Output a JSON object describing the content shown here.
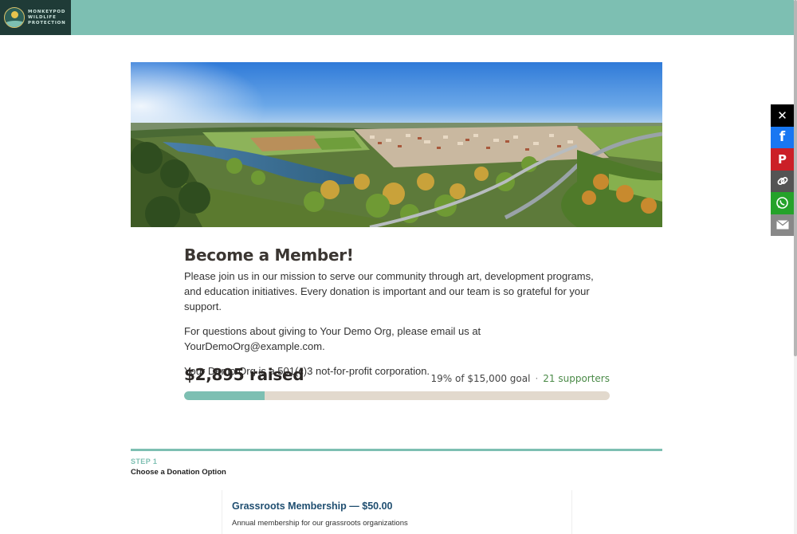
{
  "header": {
    "logo_lines": [
      "MONKEYPOD",
      "WILDLIFE",
      "PROTECTION"
    ],
    "brand_color": "#7dbfb2"
  },
  "share": [
    {
      "name": "x-icon",
      "glyph": "✕",
      "color": "#000000"
    },
    {
      "name": "facebook-icon",
      "glyph": "f",
      "color": "#1877f2"
    },
    {
      "name": "pinterest-icon",
      "glyph": "P",
      "color": "#cb2027"
    },
    {
      "name": "copy-link-icon",
      "glyph": "🔗",
      "color": "#545454"
    },
    {
      "name": "whatsapp-icon",
      "glyph": "✆",
      "color": "#25a22a"
    },
    {
      "name": "email-icon",
      "glyph": "✉",
      "color": "#888888"
    }
  ],
  "main": {
    "title": "Become a Member!",
    "intro": "Please join us in our mission to serve our community through art, development programs, and education initiatives. Every donation is important and our team is so grateful for your support.",
    "contact": "For questions about giving to Your Demo Org, please email us at YourDemoOrg@example.com.",
    "status": "Your Demo Org is a 501(c)3 not-for-profit corporation."
  },
  "fundraiser": {
    "raised": "$2,895 raised",
    "goal_text": "19% of $15,000 goal",
    "separator": "·",
    "supporters": "21 supporters",
    "progress_fraction": 0.19
  },
  "step": {
    "label": "STEP 1",
    "title": "Choose a Donation Option"
  },
  "option": {
    "title": "Grassroots Membership — $50.00",
    "description": "Annual membership for our grassroots organizations"
  }
}
